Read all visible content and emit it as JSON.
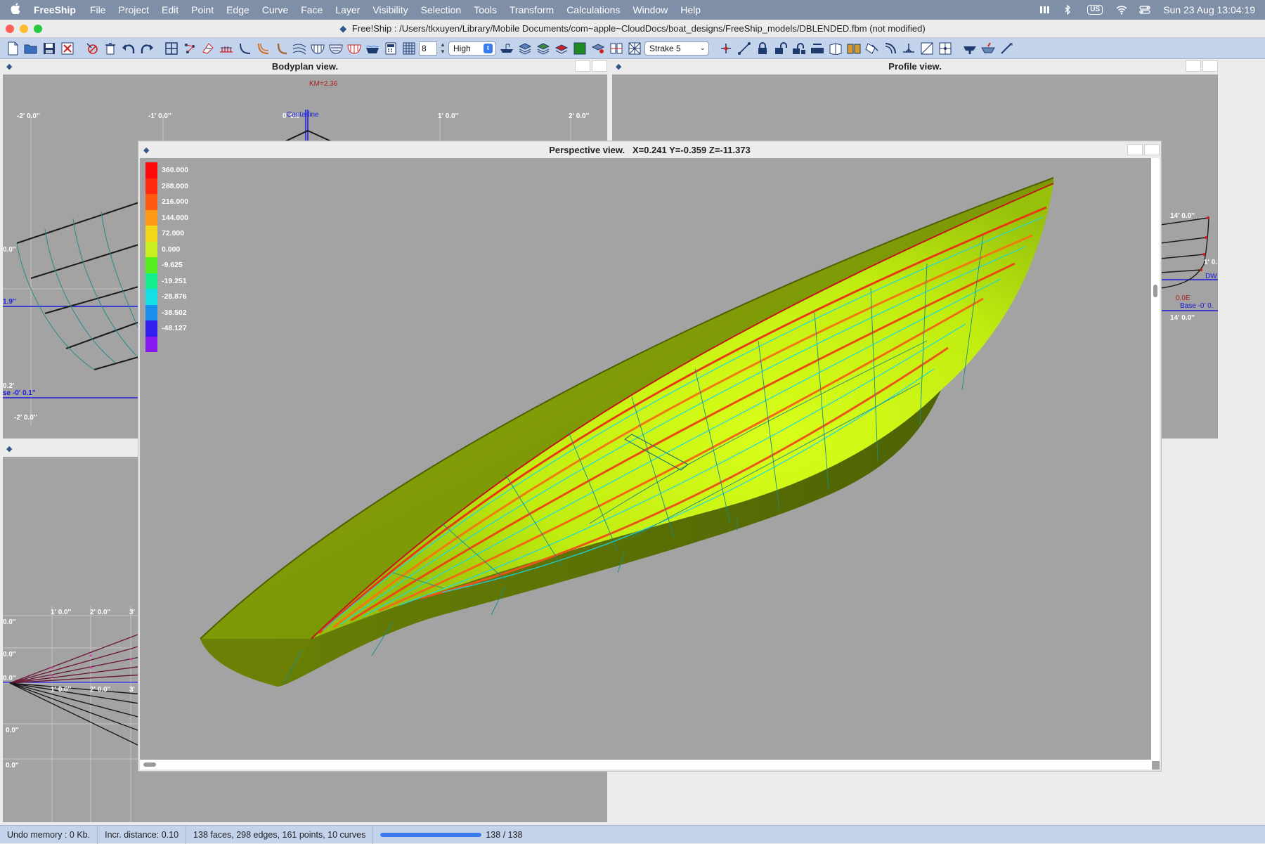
{
  "menubar": {
    "app_name": "FreeShip",
    "items": [
      "File",
      "Project",
      "Edit",
      "Point",
      "Edge",
      "Curve",
      "Face",
      "Layer",
      "Visibility",
      "Selection",
      "Tools",
      "Transform",
      "Calculations",
      "Window",
      "Help"
    ],
    "input_badge": "US",
    "clock": "Sun 23 Aug  13:04:19"
  },
  "window": {
    "title": "Free!Ship  : /Users/tkxuyen/Library/Mobile Documents/com~apple~CloudDocs/boat_designs/FreeShip_models/DBLENDED.fbm (not modified)"
  },
  "toolbar": {
    "subdivision_level": "8",
    "precision": "High",
    "strake_selector": "Strake 5"
  },
  "views": {
    "bodyplan": {
      "title": "Bodyplan view.",
      "km_label": "KM=2.36",
      "centerline_label": "Centerline",
      "top_ticks": [
        "-2' 0.0''",
        "-1' 0.0''",
        "0' 0.0''",
        "1' 0.0''",
        "2' 0.0''"
      ],
      "left_ticks": [
        "0.0''",
        "1.9''",
        "0.2'",
        "se -0' 0.1''",
        "-2' 0.0''"
      ]
    },
    "profile": {
      "title": "Profile view.",
      "labels": [
        "14' 0.0''",
        "1' 0.",
        "DW",
        "0.0E",
        "Base -0' 0.",
        "14' 0.0''"
      ]
    },
    "plan": {
      "ticks_top": [
        "1' 0.0''",
        "2' 0.0''",
        "3'"
      ],
      "ticks_mid": [
        "1' 0.0''",
        "2' 0.0''",
        "3'"
      ],
      "left_ticks": [
        "0.0''",
        "0.0''",
        "0.0''",
        "0.0''",
        "0.0''"
      ]
    },
    "perspective": {
      "title": "Perspective view.",
      "coords": "X=0.241   Y=-0.359   Z=-11.373",
      "legend": [
        {
          "value": "360.000",
          "color": "#ff0a0a"
        },
        {
          "value": "288.000",
          "color": "#ff2a10"
        },
        {
          "value": "216.000",
          "color": "#ff5a10"
        },
        {
          "value": "144.000",
          "color": "#ff9a14"
        },
        {
          "value": "72.000",
          "color": "#f0d818"
        },
        {
          "value": "0.000",
          "color": "#c8f020"
        },
        {
          "value": "-9.625",
          "color": "#56ee1e"
        },
        {
          "value": "-19.251",
          "color": "#14ee8c"
        },
        {
          "value": "-28.876",
          "color": "#12e0e6"
        },
        {
          "value": "-38.502",
          "color": "#1a90ee"
        },
        {
          "value": "-48.127",
          "color": "#3420ee"
        },
        {
          "value": "",
          "color": "#8a18f0"
        }
      ]
    }
  },
  "status": {
    "undo": "Undo memory : 0 Kb.",
    "increment": "Incr. distance: 0.10",
    "geometry": "138 faces, 298 edges, 161 points, 10 curves",
    "progress_value": 138,
    "progress_max": 138,
    "progress_text": "138 / 138"
  }
}
